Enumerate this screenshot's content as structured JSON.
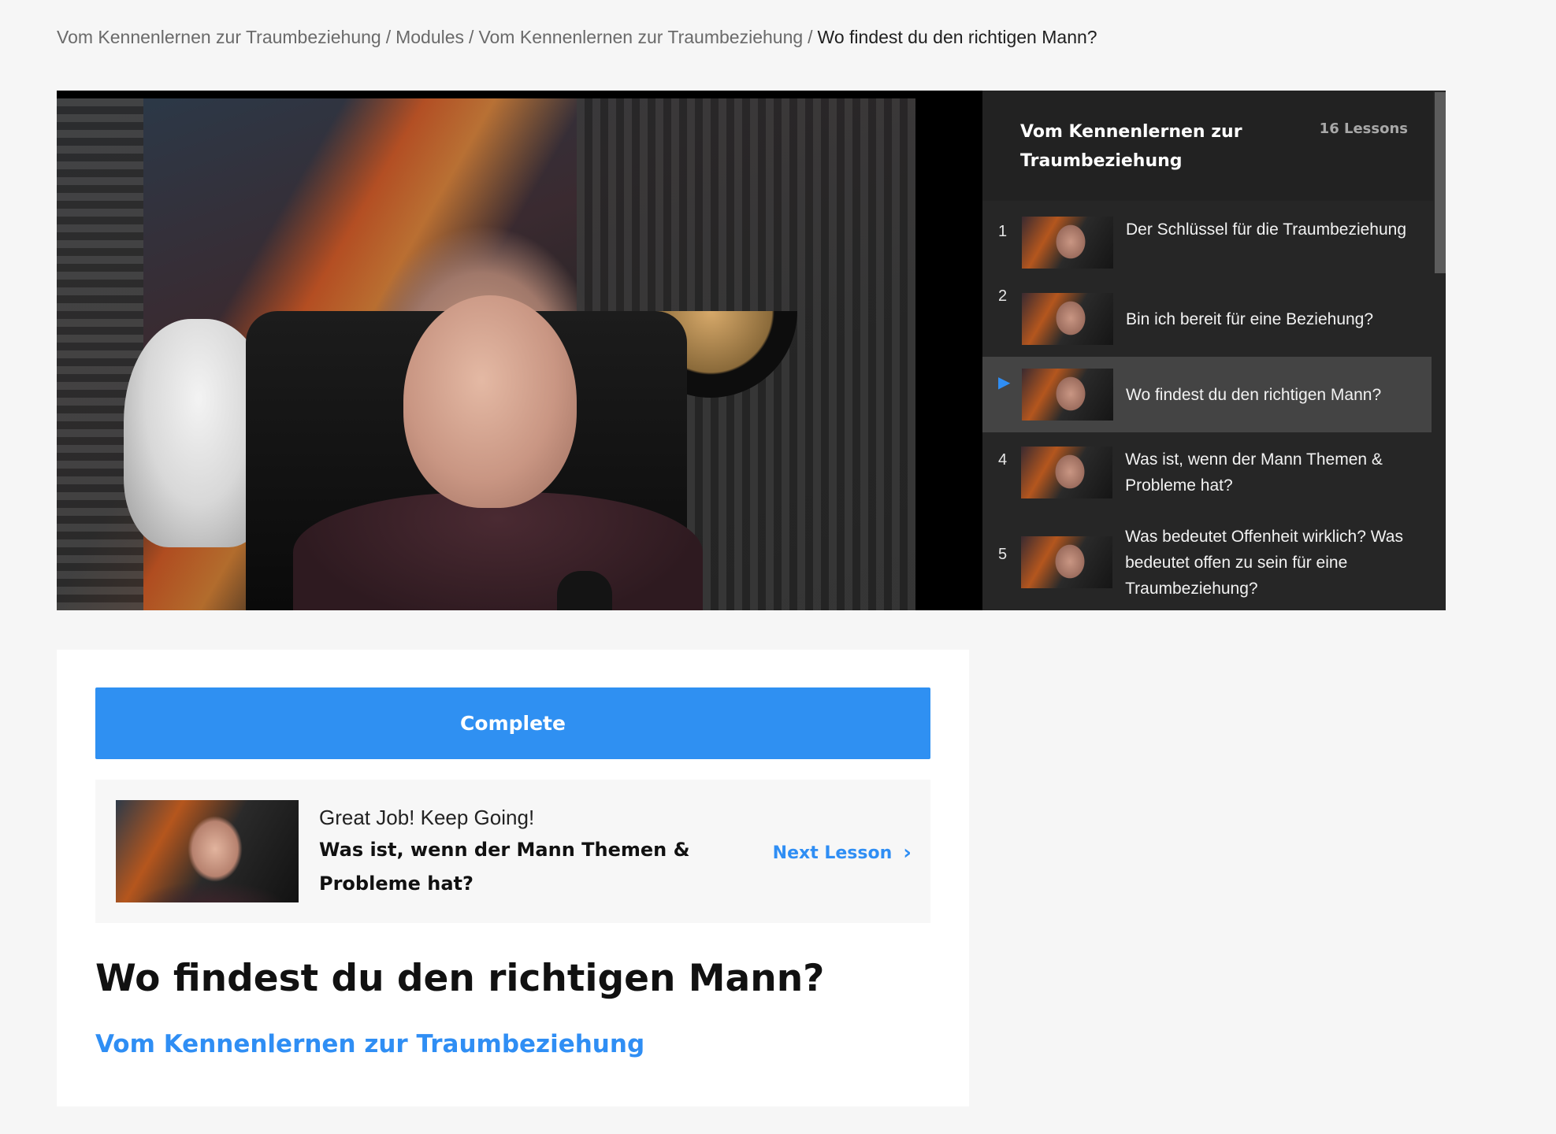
{
  "breadcrumb": {
    "items": [
      "Vom Kennenlernen zur Traumbeziehung",
      "Modules",
      "Vom Kennenlernen zur Traumbeziehung"
    ],
    "separator": "/",
    "current": "Wo findest du den richtigen Mann?"
  },
  "playlist": {
    "title": "Vom Kennenlernen zur Traumbeziehung",
    "count": "16 Lessons",
    "lessons": [
      {
        "num": "1",
        "title": "Der Schlüssel für die Traumbeziehung"
      },
      {
        "num": "2",
        "title": "Bin ich bereit für eine Beziehung?"
      },
      {
        "num": "3",
        "title": "Wo findest du den richtigen Mann?"
      },
      {
        "num": "4",
        "title": "Was ist, wenn der Mann Themen & Probleme hat?"
      },
      {
        "num": "5",
        "title": "Was bedeutet Offenheit wirklich? Was bedeutet offen zu sein für eine Traumbeziehung?"
      }
    ]
  },
  "actions": {
    "complete_label": "Complete"
  },
  "next": {
    "encouragement": "Great Job! Keep Going!",
    "lesson_title": "Was ist, wenn der Mann Themen & Probleme hat?",
    "link_label": "Next Lesson"
  },
  "lesson": {
    "heading": "Wo findest du den richtigen Mann?",
    "course_link": "Vom Kennenlernen zur Traumbeziehung"
  },
  "colors": {
    "accent": "#2f90f2",
    "playlist_bg": "#262626",
    "active_row": "#444444"
  }
}
